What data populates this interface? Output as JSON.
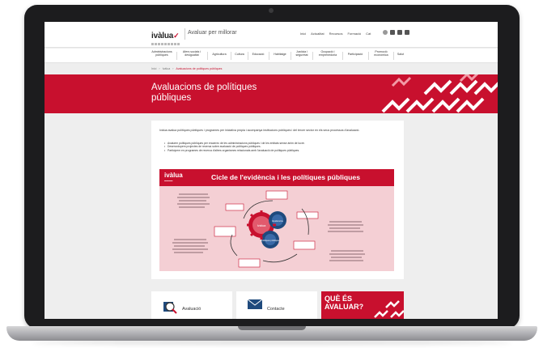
{
  "header": {
    "logo": "ivàlua",
    "tagline": "Avaluar per millorar",
    "links": [
      "Inici",
      "Actualitat",
      "Recursos",
      "Formació",
      "Cat"
    ]
  },
  "nav": [
    "Administracions públiques",
    "Afers socials i desigualtat",
    "Agricultura",
    "Cultura",
    "Educació",
    "Habitatge",
    "Justícia i seguretat",
    "Ocupació i emprenedoria",
    "Participació",
    "Promoció econòmica",
    "Salut"
  ],
  "breadcrumb": [
    "Inici",
    "Ivàlua",
    "Avaluacions de polítiques públiques"
  ],
  "hero": {
    "title": "Avaluacions de polítiques públiques"
  },
  "content": {
    "intro": "Ivàlua avalua polítiques públiques i programes per iniciativa pròpia i acompanya institucions públiques i del tercer sector en els seus processos d'avaluació.",
    "bullets": [
      "Avaluem polítiques públiques per encàrrec de les administracions públiques i de les entitats sense ànim de lucre.",
      "Desenvolupem projectes de recerca sobre avaluació de polítiques públiques.",
      "Participem en programes de recerca d'altres organismes relacionats amb l'avaluació de polítiques públiques."
    ]
  },
  "infographic": {
    "logo": "ivàlua",
    "title": "Cicle de l'evidència i les polítiques públiques",
    "center_labels": [
      "Ivàlua",
      "Evidència",
      "Polítiques públiques"
    ]
  },
  "bottom": {
    "card1": "Avaluació",
    "card2": "Contacte",
    "promo": "QUÈ ÉS AVALUAR?"
  },
  "colors": {
    "brand_red": "#c8102e",
    "infographic_bg": "#f4cfd4"
  }
}
